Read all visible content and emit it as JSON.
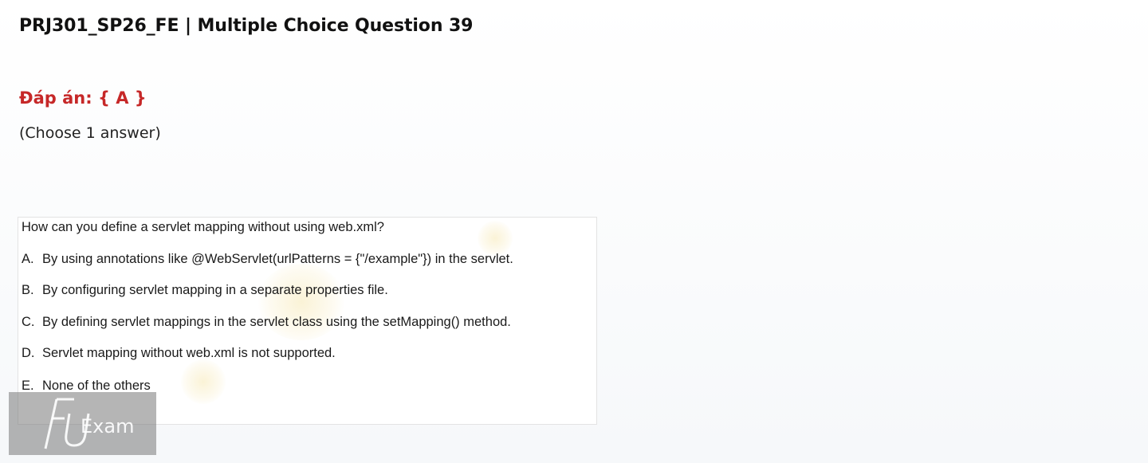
{
  "header": {
    "title": "PRJ301_SP26_FE | Multiple Choice Question 39"
  },
  "answer": {
    "label": "Đáp án: { A }"
  },
  "instruction": {
    "text": "(Choose 1 answer)"
  },
  "question": {
    "text": "How can you define a servlet mapping without using web.xml?",
    "options": [
      {
        "letter": "A.",
        "text": "By using annotations like @WebServlet(urlPatterns = {\"/example\"}) in the servlet."
      },
      {
        "letter": "B.",
        "text": "By configuring servlet mapping in a separate properties file."
      },
      {
        "letter": "C.",
        "text": "By defining servlet mappings in the servlet class using the setMapping() method."
      },
      {
        "letter": "D.",
        "text": "Servlet mapping without web.xml is not supported."
      },
      {
        "letter": "E.",
        "text": "None of the others"
      }
    ]
  },
  "watermark": {
    "logo_text": "Exam",
    "icon": "fu-exam-logo"
  },
  "colors": {
    "answer": "#c62828",
    "watermark_bg": "#787878"
  }
}
